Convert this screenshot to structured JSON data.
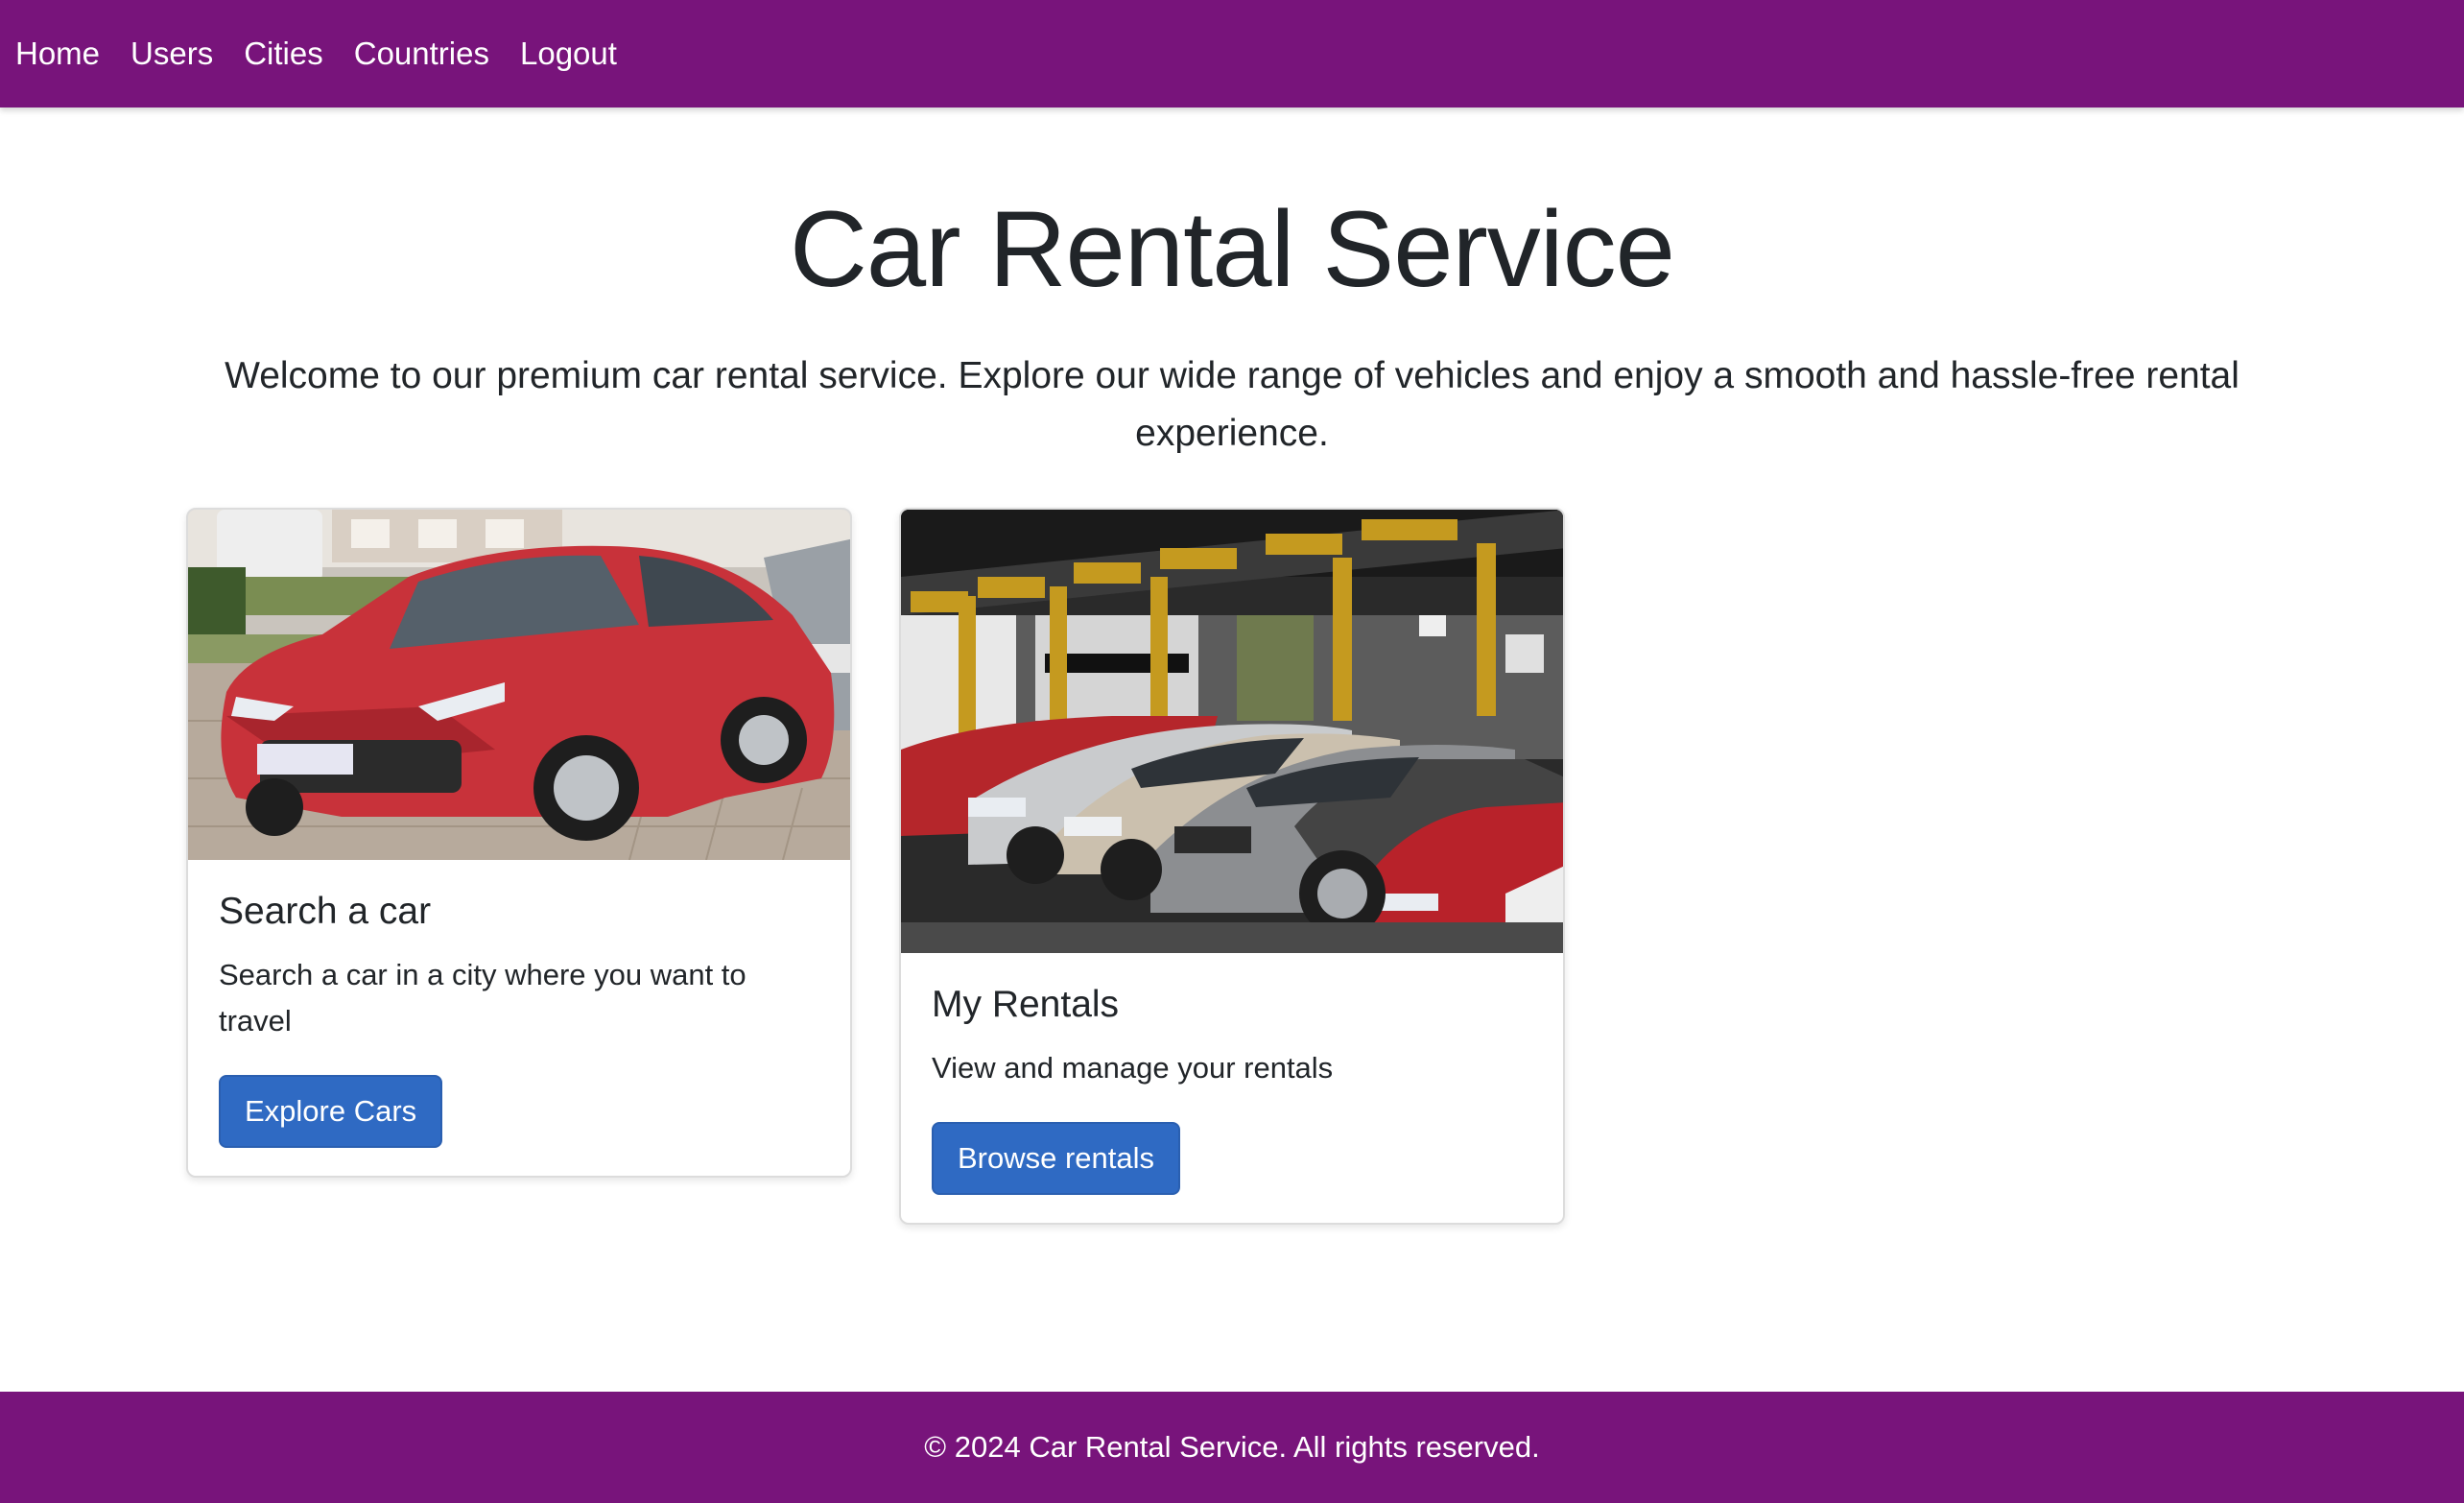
{
  "nav": {
    "items": [
      {
        "label": "Home"
      },
      {
        "label": "Users"
      },
      {
        "label": "Cities"
      },
      {
        "label": "Countries"
      },
      {
        "label": "Logout"
      }
    ]
  },
  "hero": {
    "title": "Car Rental Service",
    "text": "Welcome to our premium car rental service. Explore our wide range of vehicles and enjoy a smooth and hassle-free rental experience."
  },
  "cards": [
    {
      "image": "red-hatchback-car-photo",
      "title": "Search a car",
      "text": "Search a car in a city where you want to travel",
      "button": "Explore Cars"
    },
    {
      "image": "rental-car-lot-photo",
      "title": "My Rentals",
      "text": "View and manage your rentals",
      "button": "Browse rentals"
    }
  ],
  "footer": {
    "text": "© 2024 Car Rental Service. All rights reserved."
  },
  "colors": {
    "brand": "#78147b",
    "button": "#2f6ac3"
  }
}
